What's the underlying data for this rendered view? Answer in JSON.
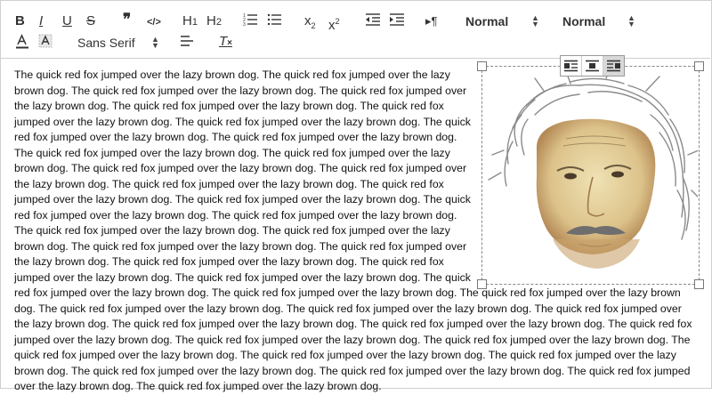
{
  "toolbar": {
    "bold": "B",
    "italic": "I",
    "underline": "U",
    "strike": "S",
    "blockquote": "❞",
    "code": "</>",
    "h1": "H",
    "h1_sub": "1",
    "h2": "H",
    "h2_sub": "2",
    "subscript_x": "x",
    "subscript_n": "2",
    "superscript_x": "x",
    "superscript_n": "2",
    "direction": "▸¶",
    "select_1": "Normal",
    "select_2": "Normal",
    "font_select": "Sans Serif",
    "clean": "T"
  },
  "image_align": [
    "align-left",
    "align-center",
    "align-right"
  ],
  "editor": {
    "text": " The quick red fox jumped over the lazy brown dog. The quick red fox jumped over the lazy brown dog. The quick red fox jumped over the lazy brown dog. The quick red fox jumped over the lazy brown dog. The quick red fox jumped over the lazy brown dog. The quick red fox jumped over the lazy brown dog. The quick red fox jumped over the lazy brown dog. The quick red fox jumped over the lazy brown dog. The quick red fox jumped over the lazy brown dog. The quick red fox jumped over the lazy brown dog. The quick red fox jumped over the lazy brown dog. The quick red fox jumped over the lazy brown dog. The quick red fox jumped over the lazy brown dog. The quick red fox jumped over the lazy brown dog. The quick red fox jumped over the lazy brown dog. The quick red fox jumped over the lazy brown dog. The quick red fox jumped over the lazy brown dog. The quick red fox jumped over the lazy brown dog. The quick red fox jumped over the lazy brown dog. The quick red fox jumped over the lazy brown dog. The quick red fox jumped over the lazy brown dog. The quick red fox jumped over the lazy brown dog. The quick red fox jumped over the lazy brown dog. The quick red fox jumped over the lazy brown dog. The quick red fox jumped over the lazy brown dog. The quick red fox jumped over the lazy brown dog. The quick red fox jumped over the lazy brown dog. The quick red fox jumped over the lazy brown dog. The quick red fox jumped over the lazy brown dog. The quick red fox jumped over the lazy brown dog. The quick red fox jumped over the lazy brown dog. The quick red fox jumped over the lazy brown dog. The quick red fox jumped over the lazy brown dog. The quick red fox jumped over the lazy brown dog. The quick red fox jumped over the lazy brown dog. The quick red fox jumped over the lazy brown dog. The quick red fox jumped over the lazy brown dog. The quick red fox jumped over the lazy brown dog. The quick red fox jumped over the lazy brown dog. The quick red fox jumped over the lazy brown dog. The quick red fox jumped over the lazy brown dog. The quick red fox jumped over the lazy brown dog. The quick red fox jumped over the lazy brown dog."
  },
  "colors": {
    "border": "#cfcfcf",
    "icon": "#333333",
    "text": "#111111",
    "hair": "#8a8a8a",
    "skin": "#e8d6a0"
  }
}
